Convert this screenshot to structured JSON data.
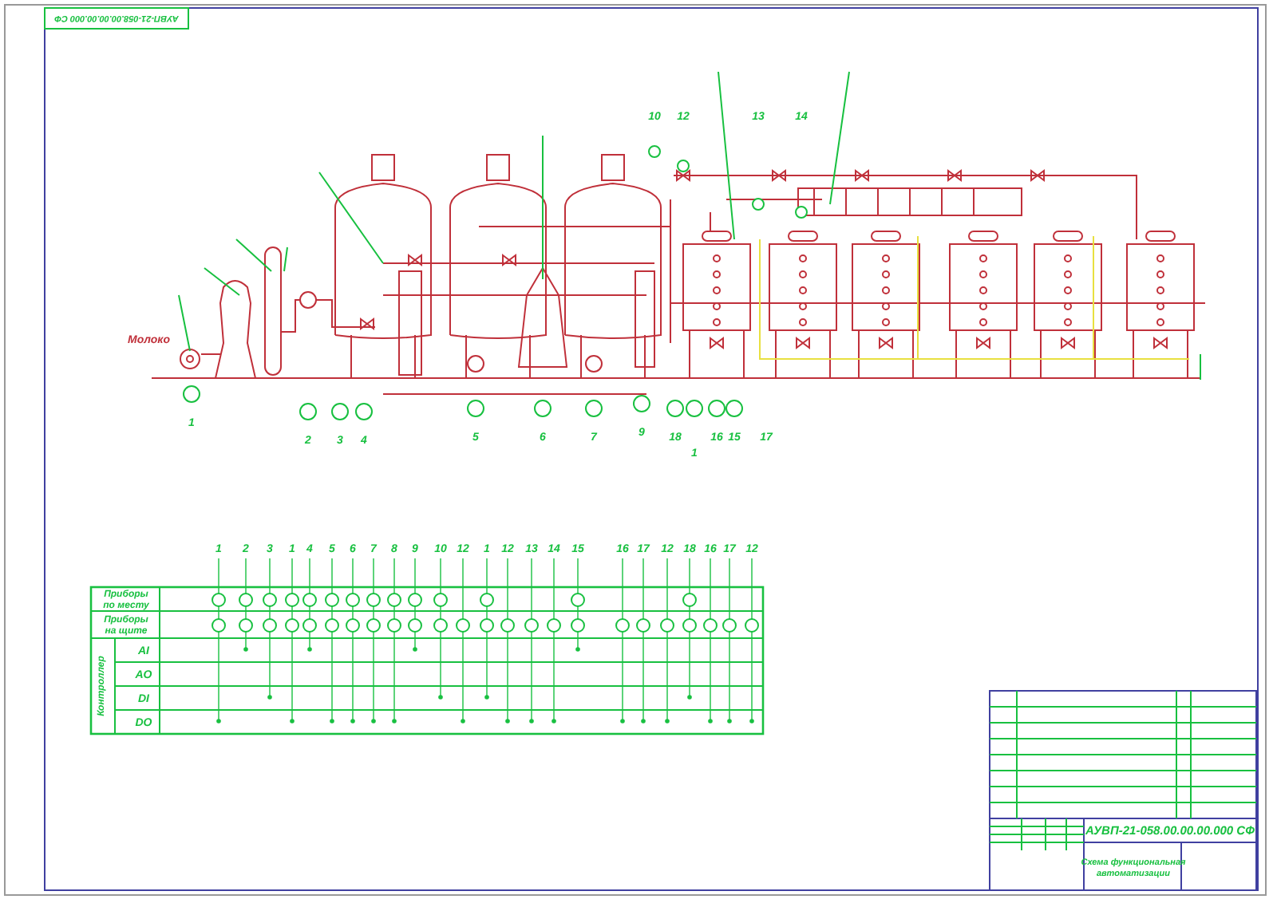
{
  "corner_stamp": "АУВП-21-058.00.00.00.000 СФ",
  "diagram": {
    "feed_label": "Молоко",
    "bottom_tags": [
      "1",
      "2",
      "3",
      "4",
      "5",
      "6",
      "7",
      "9",
      "18",
      "1",
      "16",
      "15",
      "17"
    ],
    "top_tags": [
      "10",
      "12",
      "13",
      "14"
    ]
  },
  "signal_table": {
    "field_row_label": [
      "Приборы",
      "по месту"
    ],
    "panel_row_label": [
      "Приборы",
      "на щите"
    ],
    "controller_label": "Контроллер",
    "buses": [
      "AI",
      "AO",
      "DI",
      "DO"
    ],
    "columns": [
      {
        "number": "1",
        "field": true,
        "ai": false,
        "ao": false,
        "di": false,
        "do": true
      },
      {
        "number": "2",
        "field": true,
        "ai": true,
        "ao": false,
        "di": false,
        "do": false
      },
      {
        "number": "3",
        "field": true,
        "ai": false,
        "ao": false,
        "di": true,
        "do": false
      },
      {
        "number": "1",
        "field": true,
        "ai": false,
        "ao": false,
        "di": false,
        "do": true
      },
      {
        "number": "4",
        "field": true,
        "ai": true,
        "ao": false,
        "di": false,
        "do": false
      },
      {
        "number": "5",
        "field": true,
        "ai": false,
        "ao": false,
        "di": false,
        "do": true
      },
      {
        "number": "6",
        "field": true,
        "ai": false,
        "ao": false,
        "di": false,
        "do": true
      },
      {
        "number": "7",
        "field": true,
        "ai": false,
        "ao": false,
        "di": false,
        "do": true
      },
      {
        "number": "8",
        "field": true,
        "ai": false,
        "ao": false,
        "di": false,
        "do": true
      },
      {
        "number": "9",
        "field": true,
        "ai": true,
        "ao": false,
        "di": false,
        "do": false
      },
      {
        "number": "10",
        "field": true,
        "ai": false,
        "ao": false,
        "di": true,
        "do": false
      },
      {
        "number": "12",
        "field": false,
        "ai": false,
        "ao": false,
        "di": false,
        "do": true
      },
      {
        "number": "1",
        "field": true,
        "ai": false,
        "ao": false,
        "di": true,
        "do": false
      },
      {
        "number": "12",
        "field": false,
        "ai": false,
        "ao": false,
        "di": false,
        "do": true
      },
      {
        "number": "13",
        "field": false,
        "ai": false,
        "ao": false,
        "di": false,
        "do": true
      },
      {
        "number": "14",
        "field": false,
        "ai": false,
        "ao": false,
        "di": false,
        "do": true
      },
      {
        "number": "15",
        "field": true,
        "ai": true,
        "ao": false,
        "di": false,
        "do": false
      },
      {
        "number": "16",
        "field": false,
        "ai": false,
        "ao": false,
        "di": false,
        "do": true
      },
      {
        "number": "17",
        "field": false,
        "ai": false,
        "ao": false,
        "di": false,
        "do": true
      },
      {
        "number": "12",
        "field": false,
        "ai": false,
        "ao": false,
        "di": false,
        "do": true
      },
      {
        "number": "18",
        "field": true,
        "ai": false,
        "ao": false,
        "di": true,
        "do": false
      },
      {
        "number": "16",
        "field": false,
        "ai": false,
        "ao": false,
        "di": false,
        "do": true
      },
      {
        "number": "17",
        "field": false,
        "ai": false,
        "ao": false,
        "di": false,
        "do": true
      },
      {
        "number": "12",
        "field": false,
        "ai": false,
        "ao": false,
        "di": false,
        "do": true
      }
    ]
  },
  "title_block": {
    "designation": "АУВП-21-058.00.00.00.000 СФ",
    "title_lines": [
      "Схема функциональная",
      "автоматизации"
    ]
  }
}
